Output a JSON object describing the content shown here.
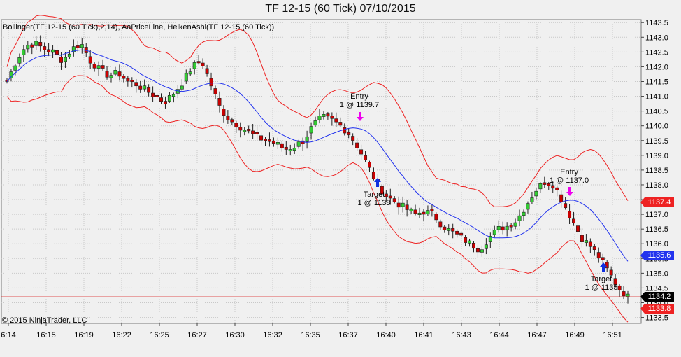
{
  "window": {
    "title": "TF 12-15 (60 Tick)  07/10/2015",
    "indicator_label": "Bollinger(TF 12-15 (60 Tick),2,14), AaPriceLine, HeikenAshi(TF 12-15 (60 Tick))",
    "copyright": "© 2015 NinjaTrader, LLC"
  },
  "colors": {
    "background": "#f0f0f0",
    "grid": "#c8c8c8",
    "bullish": "#33cc33",
    "bearish": "#cc0000",
    "bollinger_bands": "#ee2222",
    "bollinger_middle": "#2233ee",
    "price_line": "#dd2222",
    "signal_entry": "#ee00ee",
    "signal_target": "#1030e0"
  },
  "price_tags": [
    {
      "label": "1137.4",
      "value": 1137.4,
      "bg": "#ee2222"
    },
    {
      "label": "1135.6",
      "value": 1135.6,
      "bg": "#2233ee"
    },
    {
      "label": "1134.2",
      "value": 1134.2,
      "bg": "#000000"
    },
    {
      "label": "1133.8",
      "value": 1133.8,
      "bg": "#ee2222"
    }
  ],
  "annotations": [
    {
      "name": "entry-1",
      "line1": "Entry",
      "line2": "1 @ 1139.7"
    },
    {
      "name": "target-1",
      "line1": "Target",
      "line2": "1 @ 1138"
    },
    {
      "name": "entry-2",
      "line1": "Entry",
      "line2": "1 @ 1137.0"
    },
    {
      "name": "target-2",
      "line1": "Target",
      "line2": "1 @ 1135"
    }
  ],
  "chart_data": {
    "type": "candlestick",
    "title": "TF 12-15 (60 Tick)  07/10/2015",
    "ylim": [
      1133.3,
      1143.6
    ],
    "y_ticks": [
      1143.5,
      1143.0,
      1142.5,
      1142.0,
      1141.5,
      1141.0,
      1140.5,
      1140.0,
      1139.5,
      1139.0,
      1138.5,
      1138.0,
      1137.5,
      1137.0,
      1136.5,
      1136.0,
      1135.5,
      1135.0,
      1134.5,
      1134.0,
      1133.5
    ],
    "x_ticks": [
      "6:14",
      "16:15",
      "16:19",
      "16:22",
      "16:25",
      "16:27",
      "16:30",
      "16:32",
      "16:35",
      "16:37",
      "16:40",
      "16:41",
      "16:43",
      "16:44",
      "16:47",
      "16:49",
      "16:51"
    ],
    "grid": true,
    "price_line": 1134.2,
    "markers": [
      {
        "type": "entry",
        "direction": "short",
        "price": 1139.7
      },
      {
        "type": "target",
        "direction": "cover",
        "price": 1138
      },
      {
        "type": "entry",
        "direction": "short",
        "price": 1137.0
      },
      {
        "type": "target",
        "direction": "cover",
        "price": 1135
      }
    ],
    "path": [
      [
        1141.5
      ],
      [
        1142.2
      ],
      [
        1142.7
      ],
      [
        1142.8
      ],
      [
        1142.6
      ],
      [
        1142.5
      ],
      [
        1142.2
      ],
      [
        1142.6
      ],
      [
        1142.8
      ],
      [
        1142.2
      ],
      [
        1141.9
      ],
      [
        1141.7
      ],
      [
        1141.8
      ],
      [
        1141.5
      ],
      [
        1141.4
      ],
      [
        1141.2
      ],
      [
        1141.0
      ],
      [
        1140.8
      ],
      [
        1141.1
      ],
      [
        1141.5
      ],
      [
        1142.0
      ],
      [
        1142.2
      ],
      [
        1141.4
      ],
      [
        1140.6
      ],
      [
        1140.2
      ],
      [
        1140.0
      ],
      [
        1139.8
      ],
      [
        1139.6
      ],
      [
        1139.5
      ],
      [
        1139.4
      ],
      [
        1139.2
      ],
      [
        1139.3
      ],
      [
        1139.5
      ],
      [
        1140.0
      ],
      [
        1140.3
      ],
      [
        1140.2
      ],
      [
        1140.0
      ],
      [
        1139.7
      ],
      [
        1139.2
      ],
      [
        1138.6
      ],
      [
        1138.0
      ],
      [
        1137.6
      ],
      [
        1137.4
      ],
      [
        1137.2
      ],
      [
        1137.0
      ],
      [
        1137.1
      ],
      [
        1137.0
      ],
      [
        1136.6
      ],
      [
        1136.4
      ],
      [
        1136.2
      ],
      [
        1136.0
      ],
      [
        1135.8
      ],
      [
        1136.2
      ],
      [
        1136.5
      ],
      [
        1136.6
      ],
      [
        1136.8
      ],
      [
        1137.3
      ],
      [
        1137.8
      ],
      [
        1138.1
      ],
      [
        1138.0
      ],
      [
        1137.4
      ],
      [
        1136.8
      ],
      [
        1136.2
      ],
      [
        1135.9
      ],
      [
        1135.5
      ],
      [
        1135.0
      ],
      [
        1134.5
      ],
      [
        1134.2
      ]
    ]
  }
}
